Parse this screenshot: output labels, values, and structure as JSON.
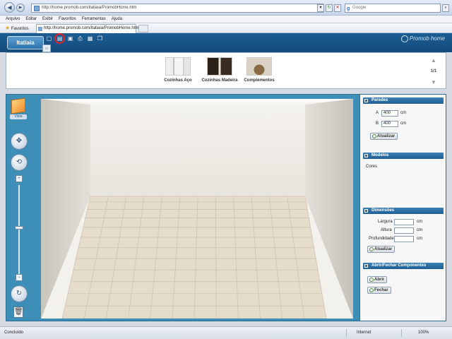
{
  "browser": {
    "url": "http://home.promob.com/itatiaia/PromobHome.htm",
    "search_placeholder": "Google",
    "menu": [
      "Arquivo",
      "Editar",
      "Exibir",
      "Favoritos",
      "Ferramentas",
      "Ajuda"
    ],
    "favorites_label": "Favoritos",
    "tab_title": "http://home.promob.com/itatiaia/PromobHome.htm",
    "status_text": "Concluído",
    "zone_text": "Internet",
    "zoom_text": "100%"
  },
  "app": {
    "brand": "Itatiaia",
    "product": "Promob home",
    "toolbar_icons": [
      "new-file-icon",
      "open-folder-icon",
      "save-icon",
      "print-icon",
      "image-icon",
      "copy-icon"
    ],
    "highlighted_tool": "open-folder-icon"
  },
  "catalog": {
    "items": [
      {
        "label": "Cozinhas Aço"
      },
      {
        "label": "Cozinhas Madeira"
      },
      {
        "label": "Complementos"
      }
    ],
    "page": "1/1"
  },
  "tools": {
    "view_label": "Vista"
  },
  "panel": {
    "walls": {
      "title": "Paredes",
      "a_label": "A",
      "a_value": "400",
      "b_label": "B",
      "b_value": "400",
      "unit": "cm",
      "update": "Atualizar"
    },
    "models": {
      "title": "Modelos",
      "colors": "Cores"
    },
    "dimensions": {
      "title": "Dimensões",
      "width_label": "Largura",
      "height_label": "Altura",
      "depth_label": "Profundidade",
      "unit": "cm",
      "update": "Atualizar"
    },
    "components": {
      "title": "Abrir/Fechar Componentes",
      "open": "Abrir",
      "close": "Fechar"
    }
  }
}
